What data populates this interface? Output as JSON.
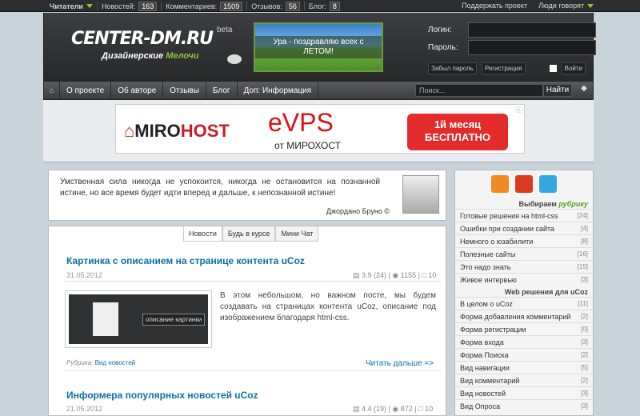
{
  "topbar": {
    "readers": "Читатели",
    "news_label": "Новостей:",
    "news_count": "163",
    "comments_label": "Комментариев:",
    "comments_count": "1509",
    "reviews_label": "Отзывов:",
    "reviews_count": "56",
    "blog_label": "Блог:",
    "blog_count": "8",
    "support": "Поддержать проект",
    "people": "Люди говорят"
  },
  "logo": {
    "title": "CENTER-DM.RU",
    "beta": "beta",
    "subtitle_a": "Дизайнерские ",
    "subtitle_b": "Мелочи"
  },
  "banner": {
    "text": "Ура - поздравляю всех с ЛЕТОМ!"
  },
  "login": {
    "login_label": "Логин:",
    "password_label": "Пароль:",
    "forgot": "Забыл пароль",
    "register": "Регистрация",
    "enter": "Войти"
  },
  "nav": {
    "items": [
      "О проекте",
      "Об авторе",
      "Отзывы",
      "Блог",
      "Доп: Информация"
    ],
    "search_placeholder": "Поиск...",
    "search_btn": "Найти"
  },
  "ad": {
    "brand_a": "MIRO",
    "brand_b": "HOST",
    "product": "eVPS",
    "from": "от МИРОХОСТ",
    "offer_1": "1й месяц",
    "offer_2": "БЕСПЛАТНО"
  },
  "quote": {
    "text": "Умственная сила никогда не успокоится, никогда не остановится на познанной истине, но все время будет идти вперед и дальше, к непознанной истине!",
    "author": "Джордано Бруно ©"
  },
  "tabs": [
    "Новости",
    "Будь в курсе",
    "Мини Чат"
  ],
  "posts": [
    {
      "title": "Картинка с описанием на странице контента uCoz",
      "date": "31.05.2012",
      "rating": "3.9 (24)",
      "views": "1155",
      "comments": "10",
      "thumb_label": "описание картинки",
      "text": "В этом небольшом, но важном посте, мы будем создавать на страницах контента uCoz, описание под изображением благодаря html-css.",
      "rubric_label": "Рубрика:",
      "rubric": "Вид новостей",
      "more": "Читать дальше =>"
    },
    {
      "title": "Информера популярных новостей uCoz",
      "date": "21.05.2012",
      "rating": "4.4 (19)",
      "views": "872",
      "comments": "10"
    }
  ],
  "sidebar": {
    "choose_a": "Выбираем ",
    "choose_b": "рубрику",
    "rubrics": [
      {
        "label": "Готовые решения на html-css",
        "count": "[24]"
      },
      {
        "label": "Ошибки при создании сайта",
        "count": "[4]"
      },
      {
        "label": "Немного о юзабилити",
        "count": "[8]"
      },
      {
        "label": "Полезные сайты",
        "count": "[16]"
      },
      {
        "label": "Это надо знать",
        "count": "[15]"
      },
      {
        "label": "Живое интервью",
        "count": "[3]"
      }
    ],
    "web_title": "Web решения для uCoz",
    "web": [
      {
        "label": "В целом о uCoz",
        "count": "[11]"
      },
      {
        "label": "Форма добавления комментарий",
        "count": "[2]"
      },
      {
        "label": "Форма регистрации",
        "count": "[0]"
      },
      {
        "label": "Форма входа",
        "count": "[3]"
      },
      {
        "label": "Форма Поиска",
        "count": "[2]"
      },
      {
        "label": "Вид навигации",
        "count": "[5]"
      },
      {
        "label": "Вид комментарий",
        "count": "[2]"
      },
      {
        "label": "Вид новостей",
        "count": "[3]"
      },
      {
        "label": "Вид Опроса",
        "count": "[3]"
      }
    ]
  }
}
